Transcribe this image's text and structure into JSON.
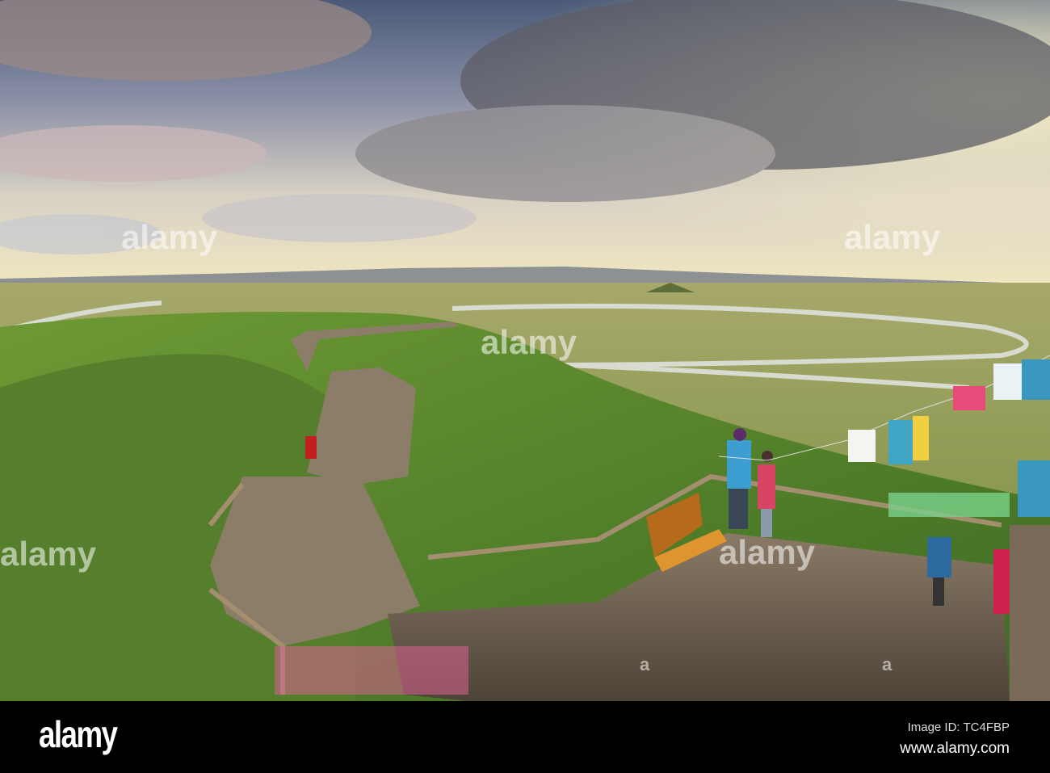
{
  "photo": {
    "description_alt": "Wooden boardwalk with prayer flags over green grassland and winding river at sunset"
  },
  "watermark": {
    "text": "alamy",
    "small_mark": "a"
  },
  "footer": {
    "logo": "alamy",
    "image_id": "Image ID: TC4FBP",
    "url": "www.alamy.com"
  }
}
